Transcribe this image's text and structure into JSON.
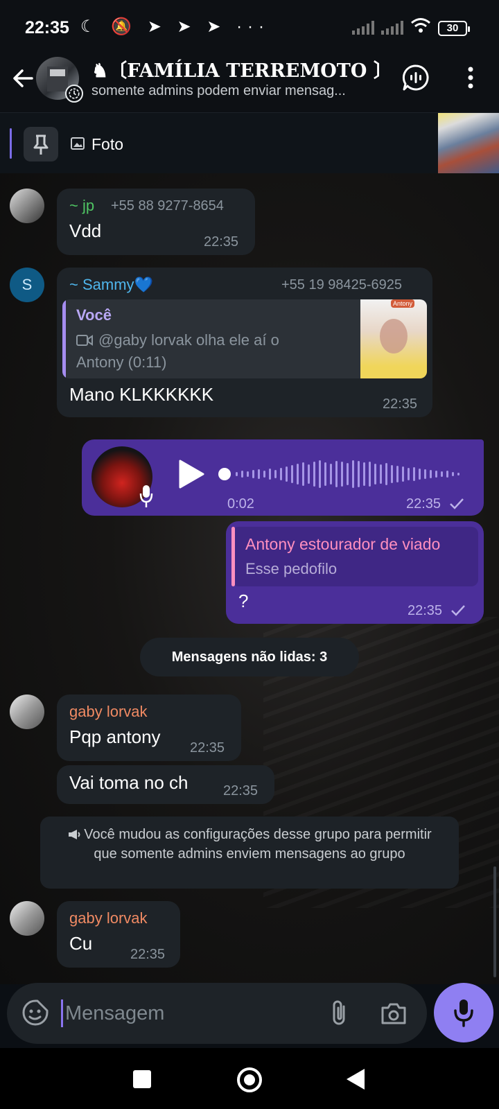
{
  "status_bar": {
    "time": "22:35",
    "left_icons": "☾ 🔕 ➤ ➤ ➤ ···",
    "battery": "30"
  },
  "header": {
    "title": "♞〔FAMÍLIA TERREMOTO 〕",
    "subtitle": "somente admins podem enviar mensag..."
  },
  "pinned": {
    "label": "Foto"
  },
  "messages": [
    {
      "name": "~ jp",
      "phone": "+55 88 9277-8654",
      "text": "Vdd",
      "time": "22:35"
    },
    {
      "avatar_letter": "S",
      "name": "~ Sammy💙",
      "phone": "+55 19 98425-6925",
      "reply_author": "Você",
      "reply_line1": "@gaby lorvak olha ele aí o",
      "reply_line2": "Antony (0:11)",
      "reply_thumb_label": "Antony",
      "text": "Mano KLKKKKKK",
      "time": "22:35"
    },
    {
      "voice_duration": "0:02",
      "time": "22:35"
    },
    {
      "reply_author": "Antony estourador de viado",
      "reply_text": "Esse pedofilo",
      "text": "?",
      "time": "22:35"
    }
  ],
  "unread_label": "Mensagens não lidas: 3",
  "gaby_messages": [
    {
      "name": "gaby lorvak",
      "text": "Pqp antony",
      "time": "22:35"
    },
    {
      "text": "Vai toma no ch",
      "time": "22:35"
    }
  ],
  "service_message": "Você mudou as configurações desse grupo para permitir que somente admins enviem mensagens ao grupo",
  "last_message": {
    "name": "gaby lorvak",
    "text": "Cu",
    "time": "22:35"
  },
  "input": {
    "placeholder": "Mensagem"
  },
  "colors": {
    "accent": "#8f7ff2",
    "outgoing_bubble": "#4b2f9a",
    "incoming_bubble": "#1e2328",
    "name_jp": "#4fc463",
    "name_sammy": "#4fb6ec",
    "name_gaby": "#f08a63",
    "reply_pink": "#ff8fbf"
  },
  "icons": {
    "back": "back-arrow-icon",
    "voice_chat": "voice-chat-icon",
    "more": "more-vert-icon",
    "pin": "pin-icon",
    "photo": "photo-icon",
    "play": "play-icon",
    "mic": "mic-icon",
    "emoji": "sticker-icon",
    "attach": "paperclip-icon",
    "camera": "camera-icon",
    "megaphone": "megaphone-icon",
    "check": "check-icon",
    "video": "video-icon"
  }
}
